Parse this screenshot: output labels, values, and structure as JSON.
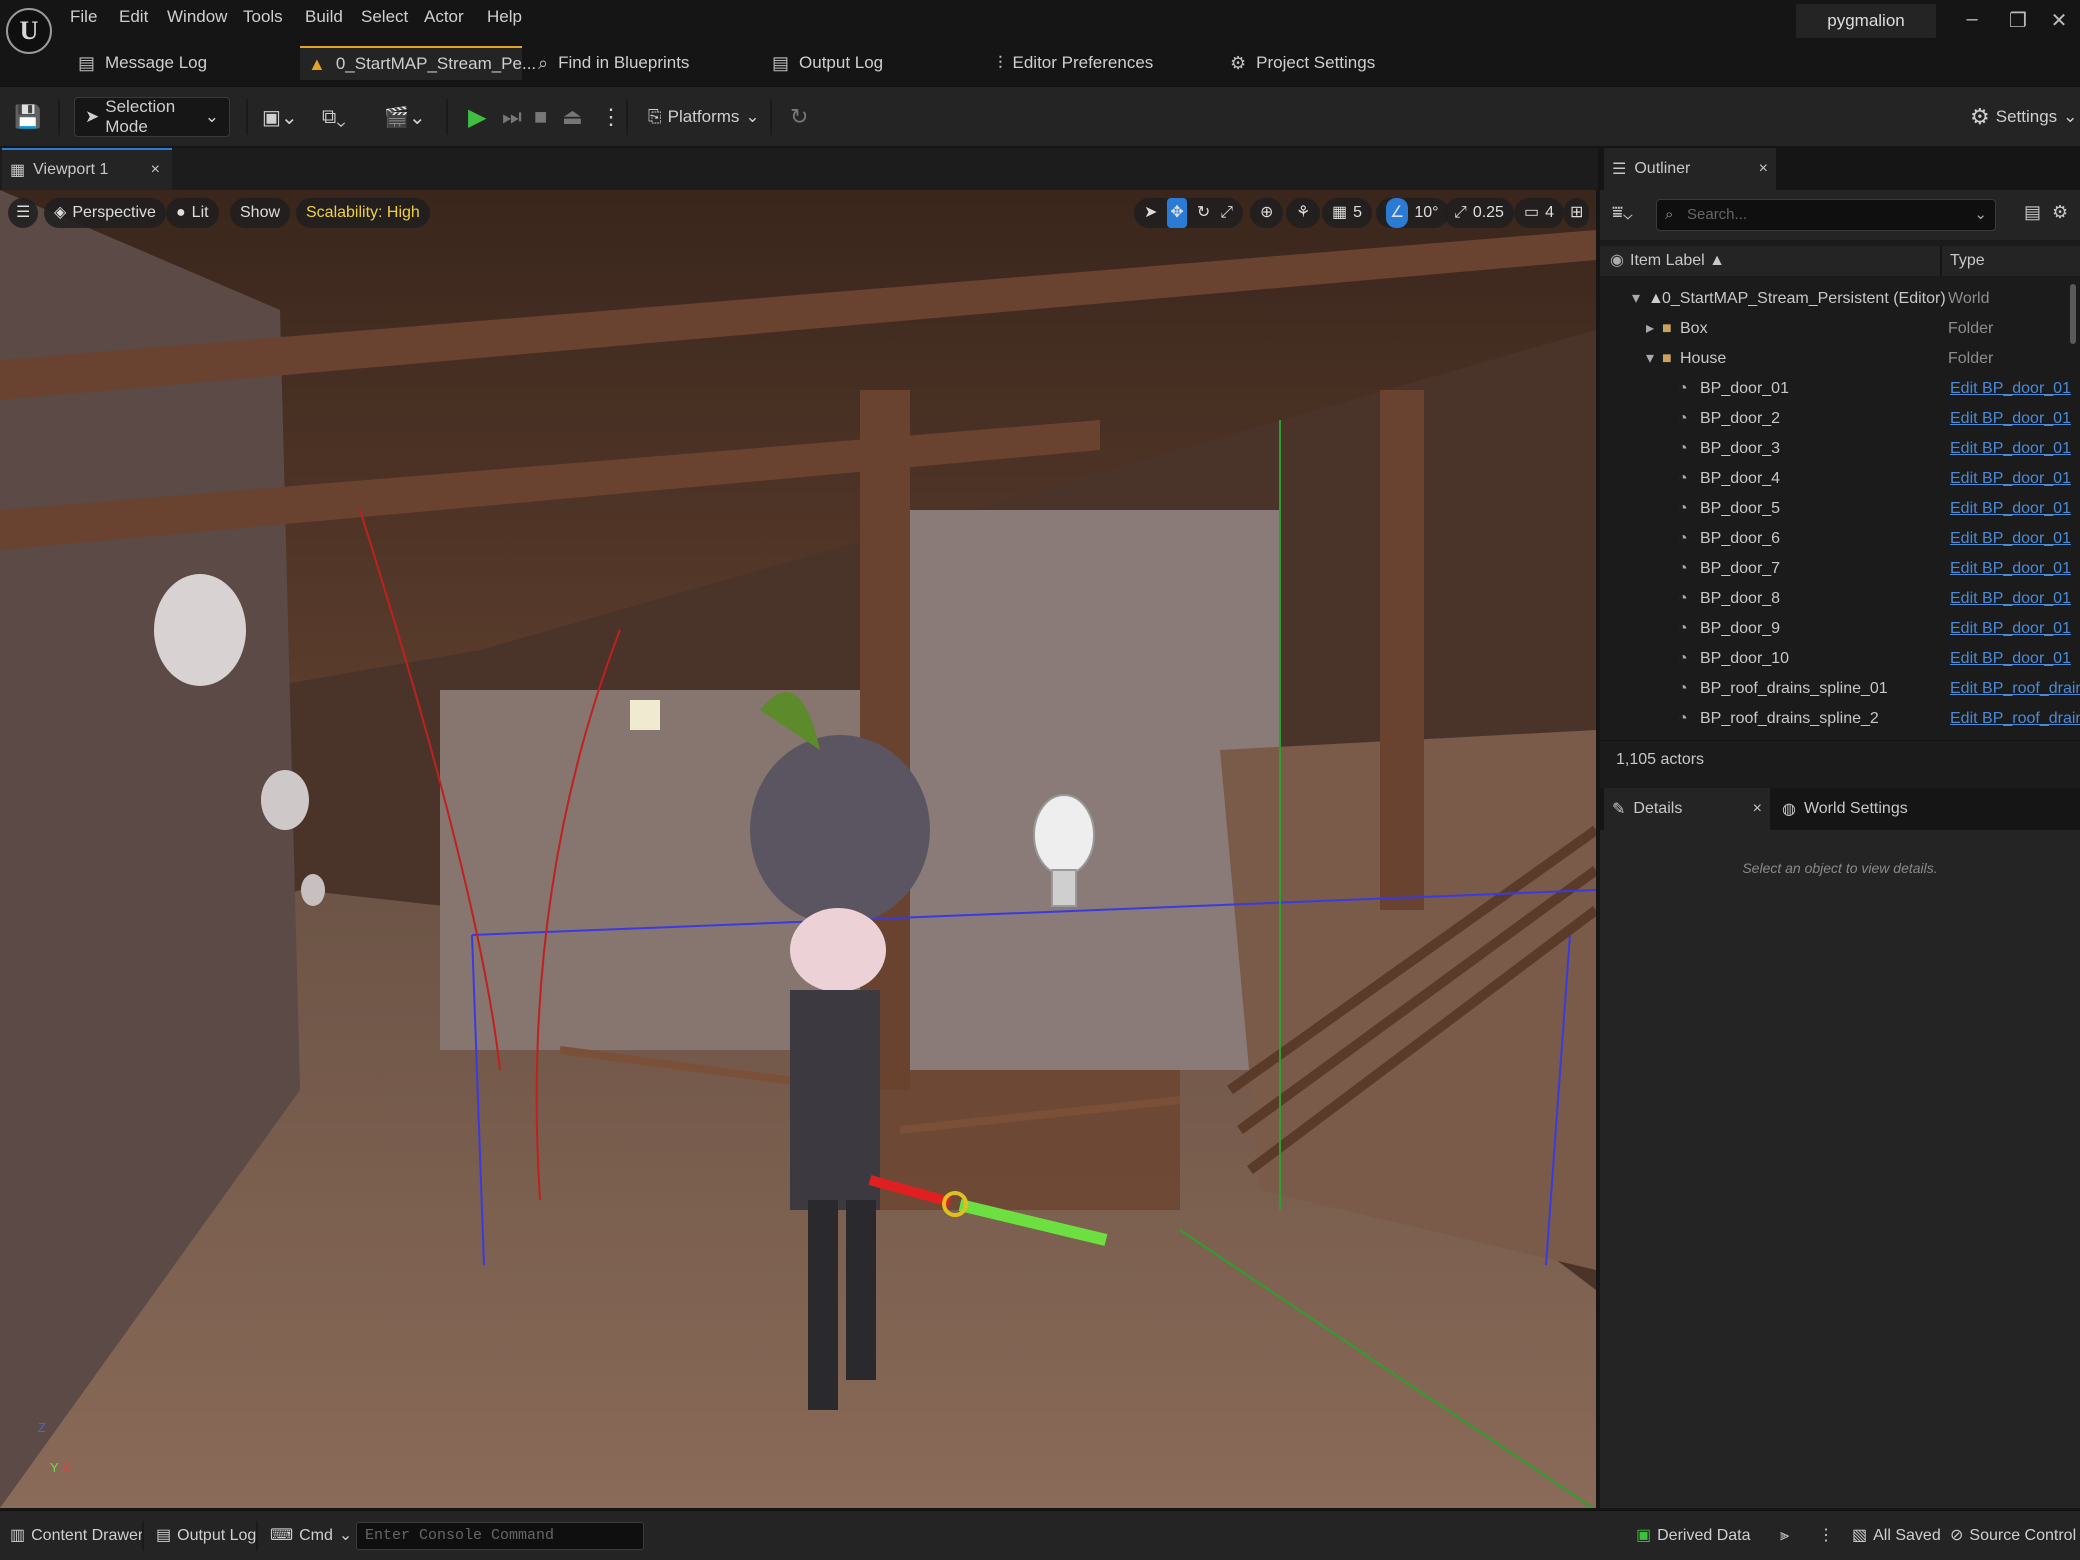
{
  "app": {
    "logo": "U",
    "user": "pygmalion"
  },
  "menu": [
    "File",
    "Edit",
    "Window",
    "Tools",
    "Build",
    "Select",
    "Actor",
    "Help"
  ],
  "tabs": [
    "Message Log",
    "0_StartMAP_Stream_Pe...",
    "Find in Blueprints",
    "Output Log",
    "Editor Preferences",
    "Project Settings"
  ],
  "toolbar": {
    "mode": "Selection Mode",
    "platforms": "Platforms",
    "settings": "Settings"
  },
  "viewport": {
    "tab": "Viewport 1",
    "perspective": "Perspective",
    "lit": "Lit",
    "show": "Show",
    "scalability": "Scalability: High",
    "grid": "5",
    "angle": "10°",
    "scale": "0.25",
    "camera": "4",
    "axis_y": "Y",
    "axis_x": "X",
    "axis_z": "Z"
  },
  "outliner": {
    "tab": "Outliner",
    "search_placeholder": "Search...",
    "col_label": "Item Label ▲",
    "col_type": "Type",
    "rows": [
      {
        "label": "0_StartMAP_Stream_Persistent (Editor)",
        "type": "World"
      },
      {
        "label": "Box",
        "type": "Folder"
      },
      {
        "label": "House",
        "type": "Folder"
      },
      {
        "label": "BP_door_01",
        "link": "Edit BP_door_01"
      },
      {
        "label": "BP_door_2",
        "link": "Edit BP_door_01"
      },
      {
        "label": "BP_door_3",
        "link": "Edit BP_door_01"
      },
      {
        "label": "BP_door_4",
        "link": "Edit BP_door_01"
      },
      {
        "label": "BP_door_5",
        "link": "Edit BP_door_01"
      },
      {
        "label": "BP_door_6",
        "link": "Edit BP_door_01"
      },
      {
        "label": "BP_door_7",
        "link": "Edit BP_door_01"
      },
      {
        "label": "BP_door_8",
        "link": "Edit BP_door_01"
      },
      {
        "label": "BP_door_9",
        "link": "Edit BP_door_01"
      },
      {
        "label": "BP_door_10",
        "link": "Edit BP_door_01"
      },
      {
        "label": "BP_roof_drains_spline_01",
        "link": "Edit BP_roof_drain"
      },
      {
        "label": "BP_roof_drains_spline_2",
        "link": "Edit BP_roof_drain"
      }
    ],
    "actors": "1,105 actors"
  },
  "details": {
    "tab": "Details",
    "world_tab": "World Settings",
    "empty": "Select an object to view details."
  },
  "status": {
    "content_drawer": "Content Drawer",
    "output_log": "Output Log",
    "cmd": "Cmd",
    "console_placeholder": "Enter Console Command",
    "derived": "Derived Data",
    "saved": "All Saved",
    "source": "Source Control"
  },
  "colors": {
    "accent": "#e6a223",
    "link": "#4c8ad6",
    "play": "#3fbf3f",
    "selected_blue": "#2a7bd6"
  }
}
